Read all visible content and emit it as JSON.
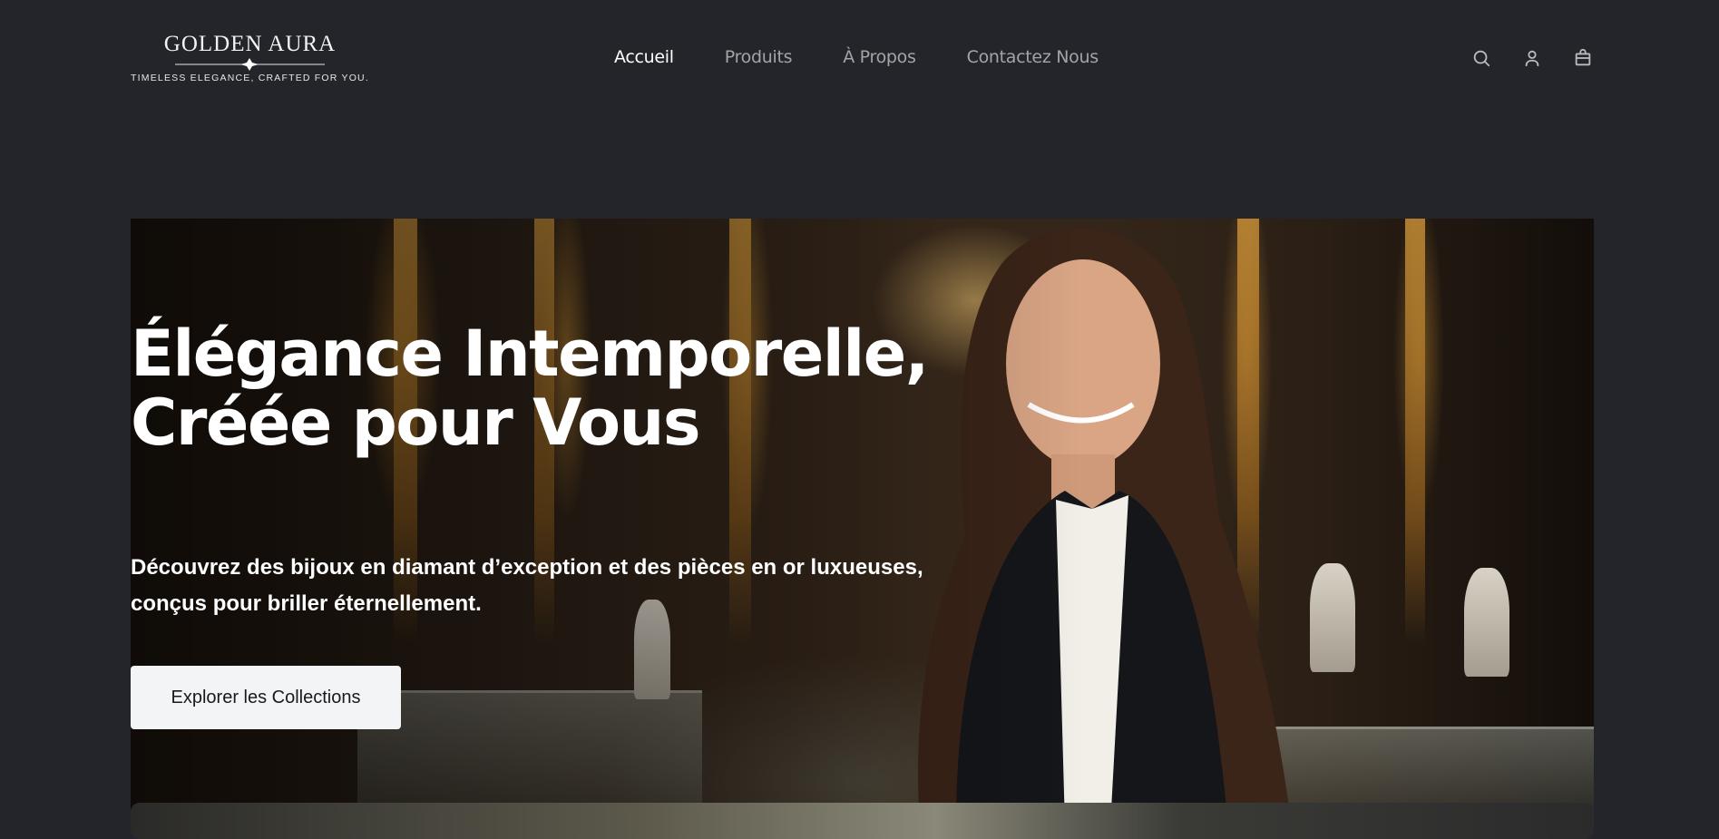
{
  "brand": {
    "name": "GOLDEN AURA",
    "tagline": "TIMELESS ELEGANCE, CRAFTED FOR YOU."
  },
  "nav": {
    "items": [
      {
        "label": "Accueil",
        "active": true
      },
      {
        "label": "Produits",
        "active": false
      },
      {
        "label": "À Propos",
        "active": false
      },
      {
        "label": "Contactez Nous",
        "active": false
      }
    ]
  },
  "actions": {
    "icons": [
      "search-icon",
      "user-icon",
      "shopping-bag-icon"
    ]
  },
  "hero": {
    "title": "Élégance Intemporelle, Créée pour Vous",
    "subtitle": "Découvrez des bijoux en diamant d’exception et des pièces en or luxueuses, conçus pour briller éternellement.",
    "cta_label": "Explorer les Collections"
  },
  "colors": {
    "page_background": "#24252a",
    "nav_active": "#ffffff",
    "nav_inactive": "#a3a4a8",
    "cta_background": "#f3f4f6",
    "cta_text": "#1a1a1a"
  }
}
